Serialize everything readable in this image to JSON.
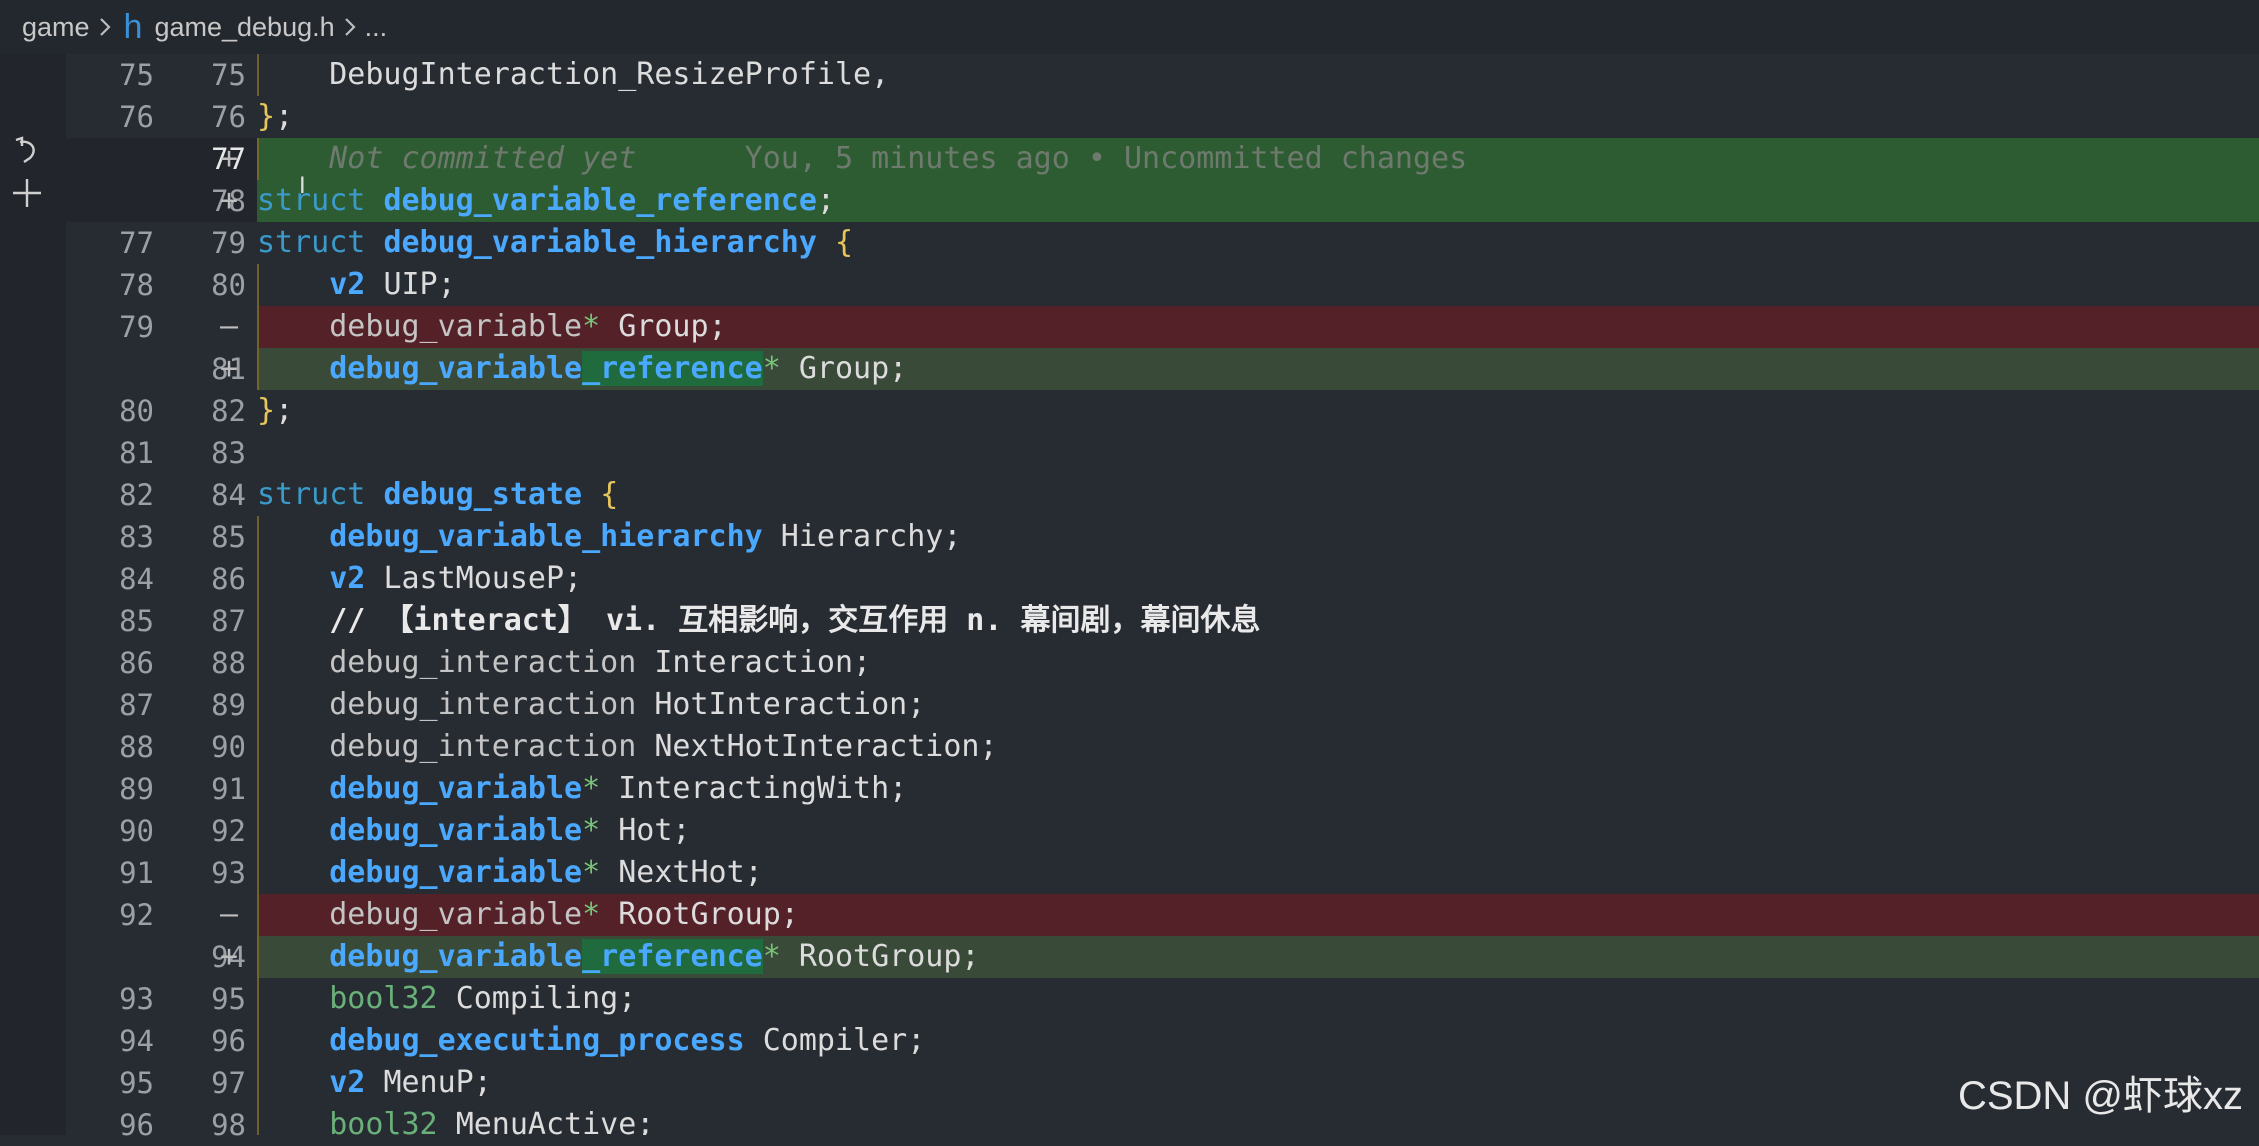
{
  "breadcrumb": {
    "folder": "game",
    "file": "game_debug.h",
    "more": "..."
  },
  "lines": [
    {
      "old": "75",
      "new": "75",
      "mark": "",
      "kind": "normal"
    },
    {
      "old": "76",
      "new": "76",
      "mark": "",
      "kind": "normal"
    },
    {
      "old": "",
      "new": "77",
      "mark": "+",
      "kind": "add"
    },
    {
      "old": "",
      "new": "78",
      "mark": "+",
      "kind": "add"
    },
    {
      "old": "77",
      "new": "79",
      "mark": "",
      "kind": "normal"
    },
    {
      "old": "78",
      "new": "80",
      "mark": "",
      "kind": "normal"
    },
    {
      "old": "79",
      "new": "",
      "mark": "—",
      "kind": "del"
    },
    {
      "old": "",
      "new": "81",
      "mark": "+",
      "kind": "addsoft"
    },
    {
      "old": "80",
      "new": "82",
      "mark": "",
      "kind": "normal"
    },
    {
      "old": "81",
      "new": "83",
      "mark": "",
      "kind": "normal"
    },
    {
      "old": "82",
      "new": "84",
      "mark": "",
      "kind": "normal"
    },
    {
      "old": "83",
      "new": "85",
      "mark": "",
      "kind": "normal"
    },
    {
      "old": "84",
      "new": "86",
      "mark": "",
      "kind": "normal"
    },
    {
      "old": "85",
      "new": "87",
      "mark": "",
      "kind": "normal"
    },
    {
      "old": "86",
      "new": "88",
      "mark": "",
      "kind": "normal"
    },
    {
      "old": "87",
      "new": "89",
      "mark": "",
      "kind": "normal"
    },
    {
      "old": "88",
      "new": "90",
      "mark": "",
      "kind": "normal"
    },
    {
      "old": "89",
      "new": "91",
      "mark": "",
      "kind": "normal"
    },
    {
      "old": "90",
      "new": "92",
      "mark": "",
      "kind": "normal"
    },
    {
      "old": "91",
      "new": "93",
      "mark": "",
      "kind": "normal"
    },
    {
      "old": "92",
      "new": "",
      "mark": "—",
      "kind": "del"
    },
    {
      "old": "",
      "new": "94",
      "mark": "+",
      "kind": "addsoft"
    },
    {
      "old": "93",
      "new": "95",
      "mark": "",
      "kind": "normal"
    },
    {
      "old": "94",
      "new": "96",
      "mark": "",
      "kind": "normal"
    },
    {
      "old": "95",
      "new": "97",
      "mark": "",
      "kind": "normal"
    },
    {
      "old": "96",
      "new": "98",
      "mark": "",
      "kind": "normal"
    }
  ],
  "code": {
    "l75": "DebugInteraction_ResizeProfile,",
    "l76_brace": "}",
    "l76_semi": ";",
    "blame_author": "Not committed yet",
    "blame_info": "You, 5 minutes ago • Uncommitted changes",
    "kw_struct": "struct",
    "l78_type": "debug_variable_reference",
    "semi": ";",
    "l79_type": "debug_variable_hierarchy",
    "open_brace": "{",
    "close_brace": "}",
    "v2": "v2",
    "uip": "UIP;",
    "debug_variable": "debug_variable",
    "star": "*",
    "group": "Group;",
    "debug_variable_reference": "debug_variable_reference",
    "debug_state": "debug_state",
    "hierarchy": "Hierarchy;",
    "lastmouse": "LastMouseP;",
    "comment": "// 【interact】 vi. 互相影响，交互作用 n. 幕间剧，幕间休息",
    "debug_interaction": "debug_interaction",
    "interaction": "Interaction;",
    "hotinteraction": "HotInteraction;",
    "nexthotinteraction": "NextHotInteraction;",
    "interactingwith": "InteractingWith;",
    "hot": "Hot;",
    "nexthot": "NextHot;",
    "rootgroup": "RootGroup;",
    "bool32": "bool32",
    "compiling": "Compiling;",
    "debug_executing_process": "debug_executing_process",
    "compiler": "Compiler;",
    "menup": "MenuP;",
    "menuactive": "MenuActive;"
  },
  "watermark": "CSDN @虾球xz",
  "colors": {
    "add": "#2e5c32",
    "addsoft": "#3a4a39",
    "del": "#552128",
    "type": "#4aa8ff",
    "keyword": "#3b9ac9"
  }
}
